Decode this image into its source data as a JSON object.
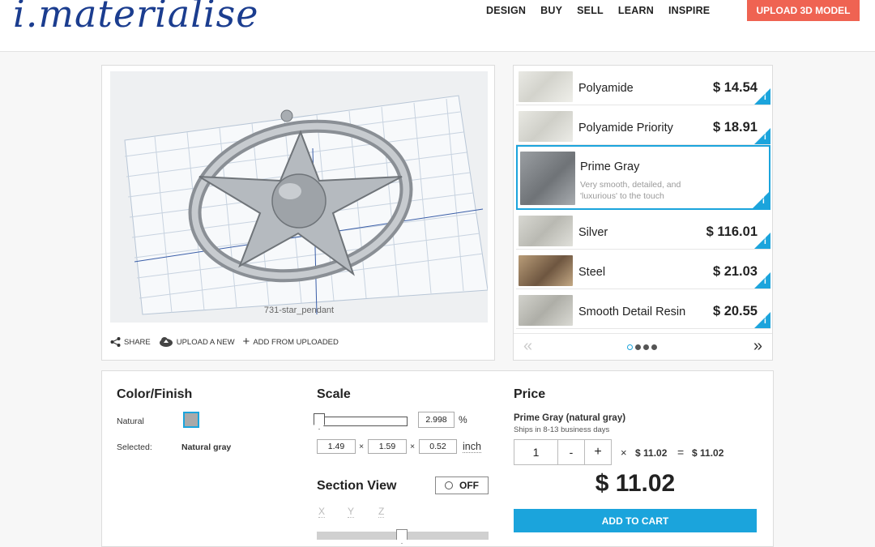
{
  "header": {
    "logo": "i.materialise",
    "nav": [
      "DESIGN",
      "BUY",
      "SELL",
      "LEARN",
      "INSPIRE"
    ],
    "upload_button": "UPLOAD 3D MODEL"
  },
  "viewer": {
    "filename": "731-star_pendant",
    "actions": {
      "share": "SHARE",
      "upload_new": "UPLOAD A NEW",
      "add_from_uploaded": "ADD FROM UPLOADED"
    }
  },
  "materials": {
    "items": [
      {
        "name": "Polyamide",
        "price": "$ 14.54"
      },
      {
        "name": "Polyamide Priority",
        "price": "$ 18.91"
      },
      {
        "name": "Prime Gray",
        "desc": "Very smooth, detailed, and 'luxurious' to the touch"
      },
      {
        "name": "Silver",
        "price": "$ 116.01"
      },
      {
        "name": "Steel",
        "price": "$ 21.03"
      },
      {
        "name": "Smooth Detail Resin",
        "price": "$ 20.55"
      }
    ],
    "pager": {
      "prev": "«",
      "next": "»",
      "pages": 4,
      "active_page": 1
    }
  },
  "color_finish": {
    "title": "Color/Finish",
    "option_label": "Natural",
    "selected_label": "Selected:",
    "selected_value": "Natural gray",
    "swatch_color": "#a9a9a9"
  },
  "scale": {
    "title": "Scale",
    "percent": "2.998",
    "percent_unit": "%",
    "dims": [
      "1.49",
      "1.59",
      "0.52"
    ],
    "times": "×",
    "unit": "inch"
  },
  "section_view": {
    "title": "Section View",
    "toggle": "OFF",
    "axes": [
      "X",
      "Y",
      "Z"
    ]
  },
  "price": {
    "title": "Price",
    "material": "Prime Gray (natural gray)",
    "ships": "Ships in 8-13 business days",
    "qty": "1",
    "minus": "-",
    "plus": "+",
    "times": "×",
    "unit_price": "$ 11.02",
    "equals": "=",
    "line_total": "$ 11.02",
    "total": "$ 11.02",
    "add_to_cart": "ADD TO CART"
  },
  "colors": {
    "accent": "#1ba4dc",
    "upload": "#ef6352",
    "logo": "#1b3d8f"
  }
}
